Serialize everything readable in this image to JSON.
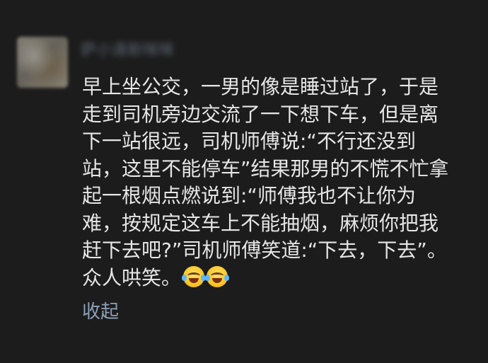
{
  "post": {
    "username": "萨小清新咪咪",
    "lines": [
      "早上坐公交，一男的像是睡过站了，于是",
      "走到司机旁边交流了一下想下车，但是离",
      "下一站很远，司机师傅说:“不行还没到",
      "站，这里不能停车”结果那男的不慌不忙拿",
      "起一根烟点燃说到:“师傅我也不让你为",
      "难，按规定这车上不能抽烟，麻烦你把我",
      "赶下去吧?”司机师傅笑道:“下去，下去”。",
      "众人哄笑。"
    ],
    "emojis": [
      "tears-of-joy-emoji",
      "tears-of-joy-emoji"
    ],
    "collapse_label": "收起"
  },
  "colors": {
    "background": "#1c1c1c",
    "text": "#e6e6e6",
    "link": "#8ea0b8"
  }
}
